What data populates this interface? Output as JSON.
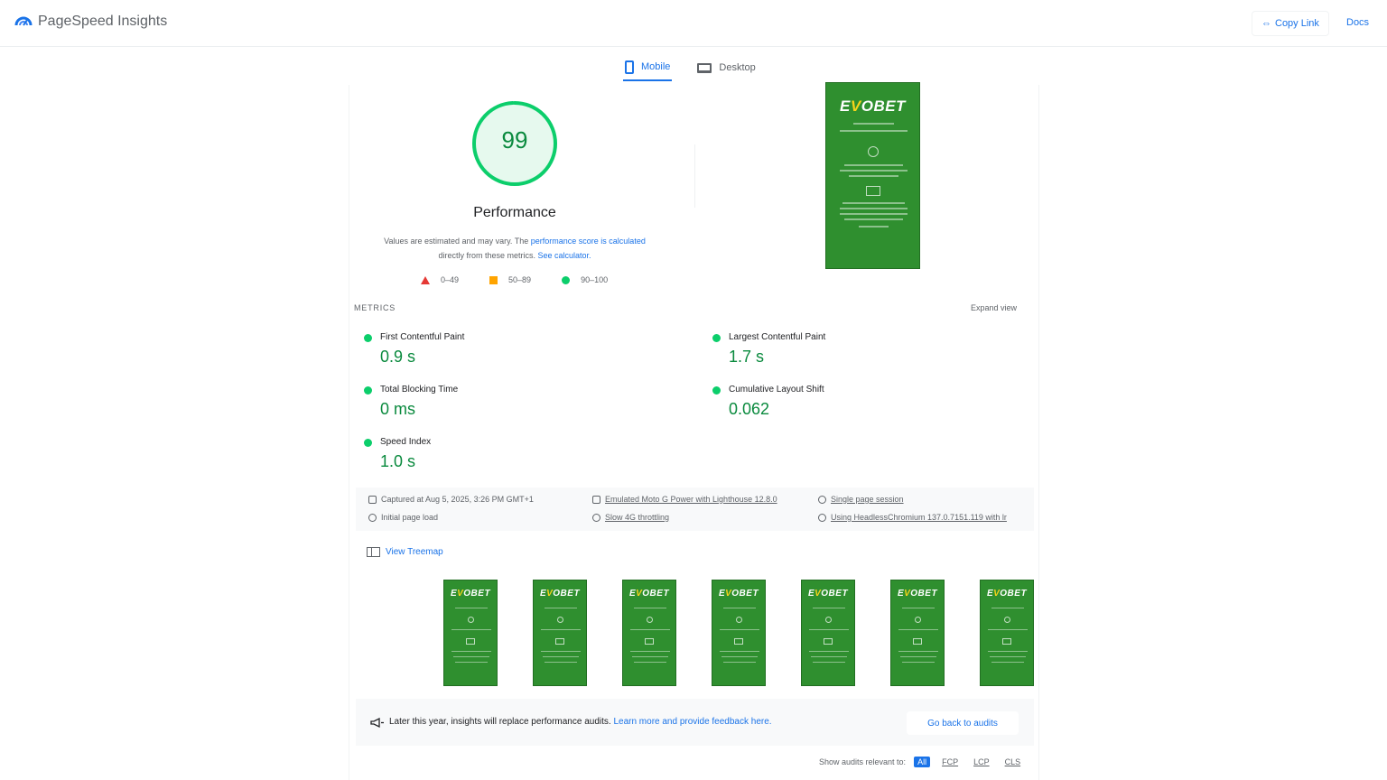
{
  "app": {
    "title": "PageSpeed Insights"
  },
  "header": {
    "copy_link": "Copy Link",
    "docs": "Docs"
  },
  "tabs": [
    {
      "label": "Mobile",
      "active": true
    },
    {
      "label": "Desktop",
      "active": false
    }
  ],
  "score": {
    "value": "99",
    "fraction": 0.99,
    "title": "Performance",
    "desc_prefix": "Values are estimated and may vary. The ",
    "desc_link1": "performance score is calculated",
    "desc_mid": " directly from these metrics. ",
    "desc_link2": "See calculator."
  },
  "legend": [
    {
      "shape": "triangle",
      "color": "#e53935",
      "range": "0–49"
    },
    {
      "shape": "square",
      "color": "#ffa400",
      "range": "50–89"
    },
    {
      "shape": "circle",
      "color": "#0cce6b",
      "range": "90–100"
    }
  ],
  "screenshot": {
    "brand_left": "E",
    "brand_v": "V",
    "brand_right": "OBET"
  },
  "metrics": {
    "section_label": "METRICS",
    "expand": "Expand view",
    "items": [
      {
        "label": "First Contentful Paint",
        "value": "0.9 s"
      },
      {
        "label": "Largest Contentful Paint",
        "value": "1.7 s"
      },
      {
        "label": "Total Blocking Time",
        "value": "0 ms"
      },
      {
        "label": "Cumulative Layout Shift",
        "value": "0.062"
      },
      {
        "label": "Speed Index",
        "value": "1.0 s"
      }
    ]
  },
  "info": {
    "captured": "Captured at Aug 5, 2025, 3:26 PM GMT+1",
    "load": "Initial page load",
    "device": "Emulated Moto G Power with Lighthouse 12.8.0",
    "throttling": "Slow 4G throttling",
    "session": "Single page session",
    "browser": "Using HeadlessChromium 137.0.7151.119 with lr"
  },
  "treemap": {
    "label": "View Treemap"
  },
  "filmstrip_count": 7,
  "notice": {
    "text": "Later this year, insights will replace performance audits. ",
    "link": "Learn more and provide feedback here.",
    "button": "Go back to audits"
  },
  "filters": {
    "label": "Show audits relevant to:",
    "chips": [
      "All",
      "FCP",
      "LCP",
      "CLS"
    ]
  },
  "colors": {
    "accent": "#1a73e8",
    "pass": "#0cce6b",
    "pass_text": "#0a8a3e",
    "screenshot_bg": "#2f8f2f"
  },
  "icons": {
    "logo": "pagespeed-logo-icon",
    "copy": "link-icon",
    "mobile": "phone-icon",
    "desktop": "laptop-icon",
    "treemap": "treemap-icon",
    "notice": "megaphone-icon"
  }
}
